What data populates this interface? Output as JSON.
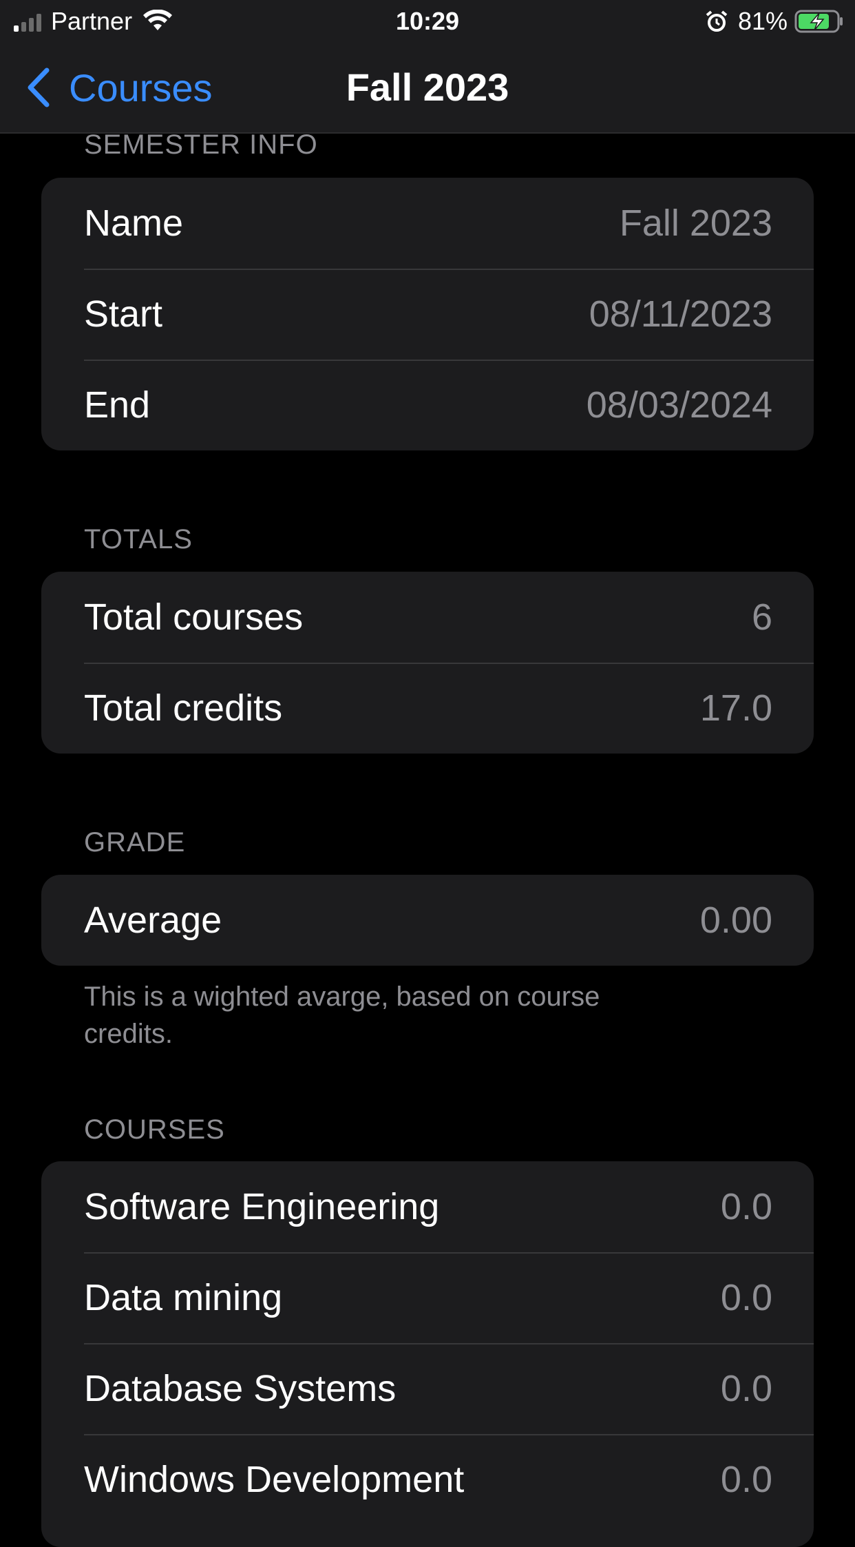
{
  "status_bar": {
    "carrier": "Partner",
    "time": "10:29",
    "battery_percent": "81%"
  },
  "nav": {
    "back_label": "Courses",
    "title": "Fall 2023"
  },
  "semester_info": {
    "header": "SEMESTER INFO",
    "rows": [
      {
        "label": "Name",
        "value": "Fall 2023"
      },
      {
        "label": "Start",
        "value": "08/11/2023"
      },
      {
        "label": "End",
        "value": "08/03/2024"
      }
    ]
  },
  "totals": {
    "header": "TOTALS",
    "rows": [
      {
        "label": "Total courses",
        "value": "6"
      },
      {
        "label": "Total credits",
        "value": "17.0"
      }
    ]
  },
  "grade": {
    "header": "GRADE",
    "rows": [
      {
        "label": "Average",
        "value": "0.00"
      }
    ],
    "footer": "This is a wighted avarge, based on course credits."
  },
  "courses": {
    "header": "COURSES",
    "rows": [
      {
        "label": "Software Engineering",
        "value": "0.0"
      },
      {
        "label": "Data mining",
        "value": "0.0"
      },
      {
        "label": "Database Systems",
        "value": "0.0"
      },
      {
        "label": "Windows Development",
        "value": "0.0"
      }
    ]
  },
  "colors": {
    "accent": "#3a8dff",
    "background": "#000000",
    "group_background": "#1c1c1e",
    "secondary_text": "#8e8e93",
    "battery_fill": "#4cd964"
  },
  "icons": {
    "back": "chevron-left-icon",
    "wifi": "wifi-icon",
    "alarm": "alarm-icon",
    "battery": "battery-charging-icon"
  }
}
